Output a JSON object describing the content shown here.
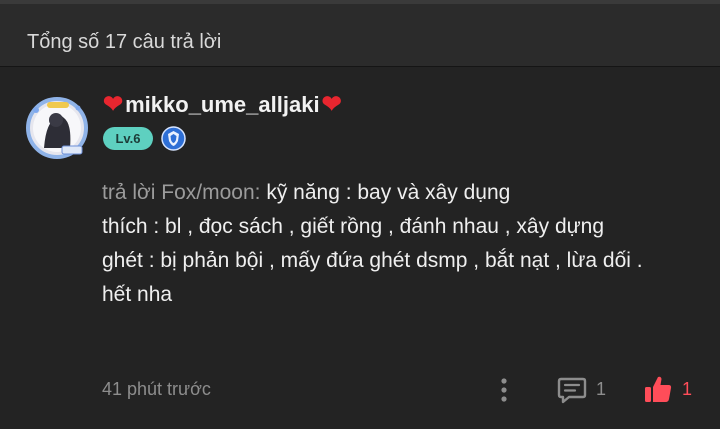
{
  "header": {
    "title": "Tổng số 17 câu trả lời"
  },
  "comment": {
    "username": "mikko_ume_alljaki",
    "level": "Lv.6",
    "reply_prefix": "trả lời Fox/moon:",
    "lines": [
      " kỹ năng : bay và xây dụng",
      "thích : bl , đọc sách , giết rồng , đánh nhau , xây dựng",
      "ghét : bị phản bội , mấy đứa ghét dsmp ,  bắt nạt ,  lừa dối .",
      "hết nha"
    ],
    "timestamp": "41 phút trước",
    "comment_count": "1",
    "like_count": "1"
  },
  "icons": {
    "heart": "heart-icon",
    "badge": "shield-badge-icon",
    "menu": "more-vertical-icon",
    "comment": "comment-icon",
    "like": "thumbs-up-icon"
  },
  "colors": {
    "like_active": "#ff4d59",
    "level_badge": "#5ed0c0",
    "heart": "#e8262f"
  }
}
